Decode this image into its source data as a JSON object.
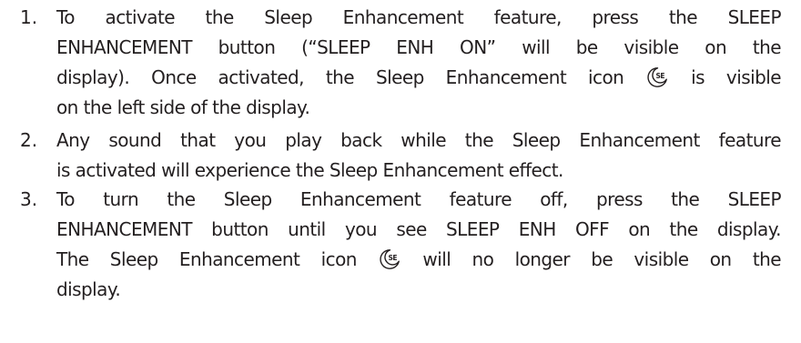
{
  "items": [
    {
      "number": "1.",
      "lines": [
        "To activate the Sleep Enhancement feature, press the SLEEP",
        "ENHANCEMENT button (“SLEEP ENH ON” will be visible on the",
        {
          "before": "display). Once activated, the Sleep Enhancement icon",
          "after": "is visible"
        },
        "on the left side of the display."
      ]
    },
    {
      "number": "2.",
      "lines": [
        "Any sound that you play back while the Sleep Enhancement feature",
        "is activated will experience the Sleep Enhancement effect."
      ]
    },
    {
      "number": "3.",
      "lines": [
        "To turn the Sleep Enhancement feature off, press the SLEEP",
        "ENHANCEMENT button until you see SLEEP ENH OFF on the display.",
        {
          "before": "The Sleep Enhancement icon",
          "after": "will no longer be visible on the"
        },
        "display."
      ]
    }
  ],
  "icons": {
    "sleep_enhancement": {
      "name": "sleep-enhancement-icon",
      "label": "SE"
    }
  }
}
